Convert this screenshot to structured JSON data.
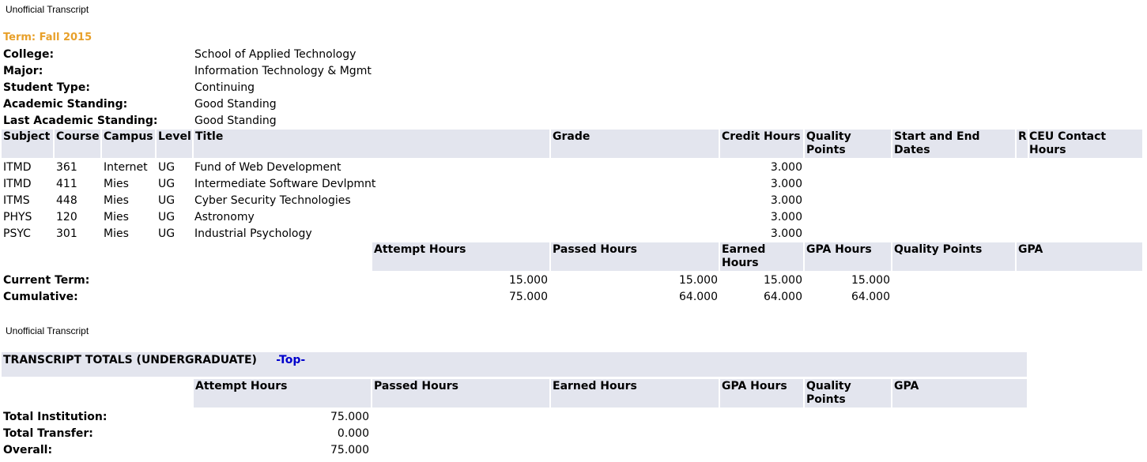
{
  "captions": {
    "first": "Unofficial Transcript",
    "second": "Unofficial Transcript"
  },
  "term": {
    "label": "Term: Fall 2015",
    "info": [
      {
        "label": "College:",
        "value": "School of Applied Technology"
      },
      {
        "label": "Major:",
        "value": "Information Technology & Mgmt"
      },
      {
        "label": "Student Type:",
        "value": "Continuing"
      },
      {
        "label": "Academic Standing:",
        "value": "Good Standing"
      },
      {
        "label": "Last Academic Standing:",
        "value": "Good Standing"
      }
    ]
  },
  "course_table": {
    "headers": [
      "Subject",
      "Course",
      "Campus",
      "Level",
      "Title",
      "Grade",
      "Credit Hours",
      "Quality Points",
      "Start and End Dates",
      "R",
      "CEU Contact Hours"
    ],
    "rows": [
      {
        "subject": "ITMD",
        "course": "361",
        "campus": "Internet",
        "level": "UG",
        "title": "Fund of Web Development",
        "credit": "3.000"
      },
      {
        "subject": "ITMD",
        "course": "411",
        "campus": "Mies",
        "level": "UG",
        "title": "Intermediate Software Devlpmnt",
        "credit": "3.000"
      },
      {
        "subject": "ITMS",
        "course": "448",
        "campus": "Mies",
        "level": "UG",
        "title": "Cyber Security Technologies",
        "credit": "3.000"
      },
      {
        "subject": "PHYS",
        "course": "120",
        "campus": "Mies",
        "level": "UG",
        "title": "Astronomy",
        "credit": "3.000"
      },
      {
        "subject": "PSYC",
        "course": "301",
        "campus": "Mies",
        "level": "UG",
        "title": "Industrial Psychology",
        "credit": "3.000"
      }
    ]
  },
  "term_totals": {
    "headers": [
      "Attempt Hours",
      "Passed Hours",
      "Earned Hours",
      "GPA Hours",
      "Quality Points",
      "GPA"
    ],
    "current": {
      "label": "Current Term:",
      "attempt": "15.000",
      "passed": "15.000",
      "earned": "15.000",
      "gpa_hours": "15.000"
    },
    "cumulative": {
      "label": "Cumulative:",
      "attempt": "75.000",
      "passed": "64.000",
      "earned": "64.000",
      "gpa_hours": "64.000"
    }
  },
  "transcript_totals": {
    "title": "TRANSCRIPT TOTALS (UNDERGRADUATE)",
    "top_link": "-Top-",
    "headers": [
      "Attempt Hours",
      "Passed Hours",
      "Earned Hours",
      "GPA Hours",
      "Quality Points",
      "GPA"
    ],
    "rows": [
      {
        "label": "Total Institution:",
        "attempt": "75.000"
      },
      {
        "label": "Total Transfer:",
        "attempt": "0.000"
      },
      {
        "label": "Overall:",
        "attempt": "75.000"
      }
    ]
  },
  "colors": {
    "header_bg": "#e3e5ee",
    "term_color": "#e8a02a",
    "link_color": "#0000cc"
  }
}
